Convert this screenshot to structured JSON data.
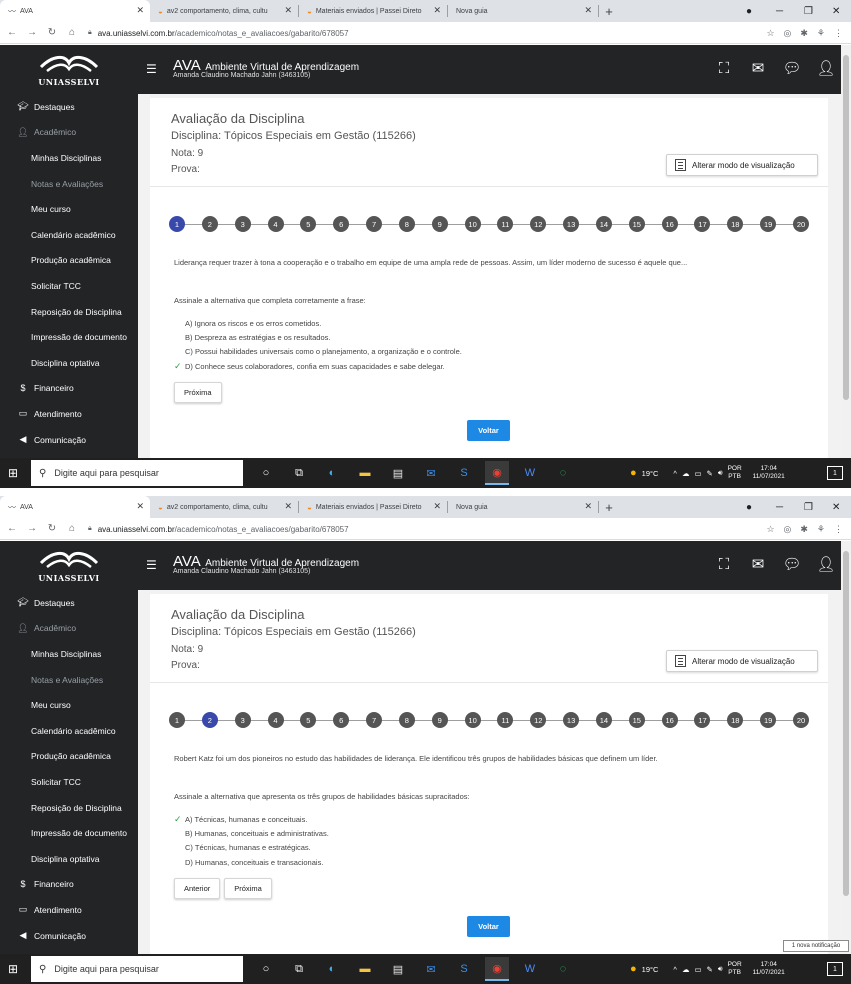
{
  "browser": {
    "tabs": [
      {
        "label": "AVA",
        "icon": "uniasselvi-logo-icon"
      },
      {
        "label": "av2 comportamento, clima, cultu",
        "icon": "passei-direto-icon"
      },
      {
        "label": "Materiais enviados | Passei Direto",
        "icon": "passei-direto-icon"
      },
      {
        "label": "Nova guia",
        "icon": ""
      }
    ],
    "url_host": "ava.uniasselvi.com.br",
    "url_path": "/academico/notas_e_avaliacoes/gabarito/678057"
  },
  "header": {
    "logo_text": "UNIASSELVI",
    "ava": "AVA",
    "title": "Ambiente Virtual de Aprendizagem",
    "user": "Amanda Claudino Machado Jahn (3463105)"
  },
  "sidebar": {
    "items": [
      {
        "label": "Destaques",
        "kind": "top",
        "icon": "graduation-cap-icon"
      },
      {
        "label": "Acadêmico",
        "kind": "top-muted",
        "icon": "user-icon"
      },
      {
        "label": "Minhas Disciplinas",
        "kind": "sub"
      },
      {
        "label": "Notas e Avaliações",
        "kind": "sub-muted"
      },
      {
        "label": "Meu curso",
        "kind": "sub"
      },
      {
        "label": "Calendário acadêmico",
        "kind": "sub"
      },
      {
        "label": "Produção acadêmica",
        "kind": "sub"
      },
      {
        "label": "Solicitar TCC",
        "kind": "sub"
      },
      {
        "label": "Reposição de Disciplina",
        "kind": "sub"
      },
      {
        "label": "Impressão de documento",
        "kind": "sub"
      },
      {
        "label": "Disciplina optativa",
        "kind": "sub"
      },
      {
        "label": "Financeiro",
        "kind": "top",
        "icon": "dollar-icon"
      },
      {
        "label": "Atendimento",
        "kind": "top",
        "icon": "monitor-icon"
      },
      {
        "label": "Comunicação",
        "kind": "top",
        "icon": "megaphone-icon"
      }
    ]
  },
  "card": {
    "title": "Avaliação da Disciplina",
    "discipline": "Disciplina: Tópicos Especiais em Gestão (115266)",
    "nota": "Nota: 9",
    "prova": "Prova:",
    "view_button": "Alterar modo de visualização",
    "back_button": "Voltar",
    "prev_button": "Anterior",
    "next_button": "Próxima"
  },
  "steps": [
    "1",
    "2",
    "3",
    "4",
    "5",
    "6",
    "7",
    "8",
    "9",
    "10",
    "11",
    "12",
    "13",
    "14",
    "15",
    "16",
    "17",
    "18",
    "19",
    "20"
  ],
  "frames": [
    {
      "active_step": 0,
      "question": "Liderança requer trazer à tona a cooperação e o trabalho em equipe de uma ampla rede de pessoas. Assim, um líder moderno de sucesso é aquele que...",
      "instruction": "Assinale a alternativa que completa corretamente a frase:",
      "options": [
        {
          "text": "A) Ignora os riscos e os erros cometidos.",
          "correct": false
        },
        {
          "text": "B) Despreza as estratégias e os resultados.",
          "correct": false
        },
        {
          "text": "C) Possui habilidades universais como o planejamento, a organização e o controle.",
          "correct": false
        },
        {
          "text": "D) Conhece seus colaboradores, confia em suas capacidades e sabe delegar.",
          "correct": true
        }
      ],
      "show_prev": false
    },
    {
      "active_step": 1,
      "question": "Robert Katz foi um dos pioneiros no estudo das habilidades de liderança. Ele identificou três grupos de habilidades básicas que definem um líder.",
      "instruction": "Assinale a alternativa que apresenta os três grupos de habilidades básicas supracitados:",
      "options": [
        {
          "text": "A) Técnicas, humanas e conceituais.",
          "correct": true
        },
        {
          "text": "B) Humanas, conceituais e administrativas.",
          "correct": false
        },
        {
          "text": "C) Técnicas, humanas e estratégicas.",
          "correct": false
        },
        {
          "text": "D) Humanas, conceituais e transacionais.",
          "correct": false
        }
      ],
      "show_prev": true
    }
  ],
  "taskbar": {
    "search_placeholder": "Digite aqui para pesquisar",
    "weather": "19°C",
    "lang_top": "POR",
    "lang_bottom": "PTB",
    "time": "17:04",
    "date": "11/07/2021",
    "notification_count": "1",
    "toast": "1 nova notificação"
  },
  "colors": {
    "header_bg": "#222426",
    "active_step": "#3949ab",
    "step": "#555555",
    "correct_check": "#2e9e44",
    "voltar_button": "#1e88e5"
  }
}
